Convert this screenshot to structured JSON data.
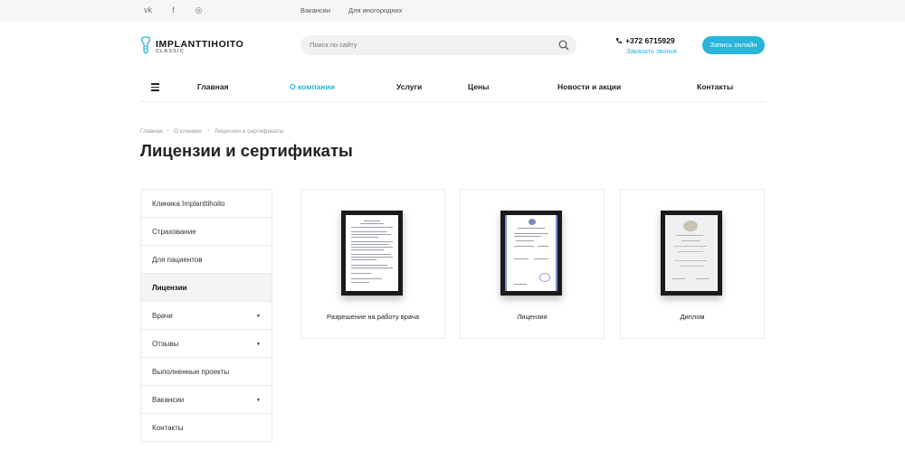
{
  "topbar": {
    "social": [
      {
        "icon": "vk-icon",
        "glyph": "vk"
      },
      {
        "icon": "facebook-icon",
        "glyph": "f"
      },
      {
        "icon": "instagram-icon",
        "glyph": "◎"
      }
    ],
    "links": [
      "Вакансии",
      "Для иногородних"
    ]
  },
  "header": {
    "logo_title": "IMPLANTTIHOITO",
    "logo_sub": "CLASSIC",
    "search_placeholder": "Поиск по сайту",
    "phone": "+372 6715929",
    "callback": "Заказать звонок",
    "cta": "Запись онлайн",
    "accent": "#29b4d8"
  },
  "nav": {
    "items": [
      "Главная",
      "О компании",
      "Услуги",
      "Цены",
      "Новости и акции",
      "Контакты"
    ],
    "active": "О компании"
  },
  "breadcrumb": [
    "Главная",
    "О клинике",
    "Лицензии и сертификаты"
  ],
  "page_title": "Лицензии и сертификаты",
  "sidebar": {
    "items": [
      {
        "label": "Клиника Implanttihoito",
        "caret": ""
      },
      {
        "label": "Страхование",
        "caret": ""
      },
      {
        "label": "Для пациентов",
        "caret": ""
      },
      {
        "label": "Лицензии",
        "caret": ""
      },
      {
        "label": "Врачи",
        "caret": "▼"
      },
      {
        "label": "Отзывы",
        "caret": "▼"
      },
      {
        "label": "Выполненные проекты",
        "caret": ""
      },
      {
        "label": "Вакансии",
        "caret": "▼"
      },
      {
        "label": "Контакты",
        "caret": ""
      }
    ],
    "active": "Лицензии"
  },
  "cards": [
    {
      "label": "Разрешение на работу врача"
    },
    {
      "label": "Лицензия"
    },
    {
      "label": "Диплом"
    }
  ]
}
